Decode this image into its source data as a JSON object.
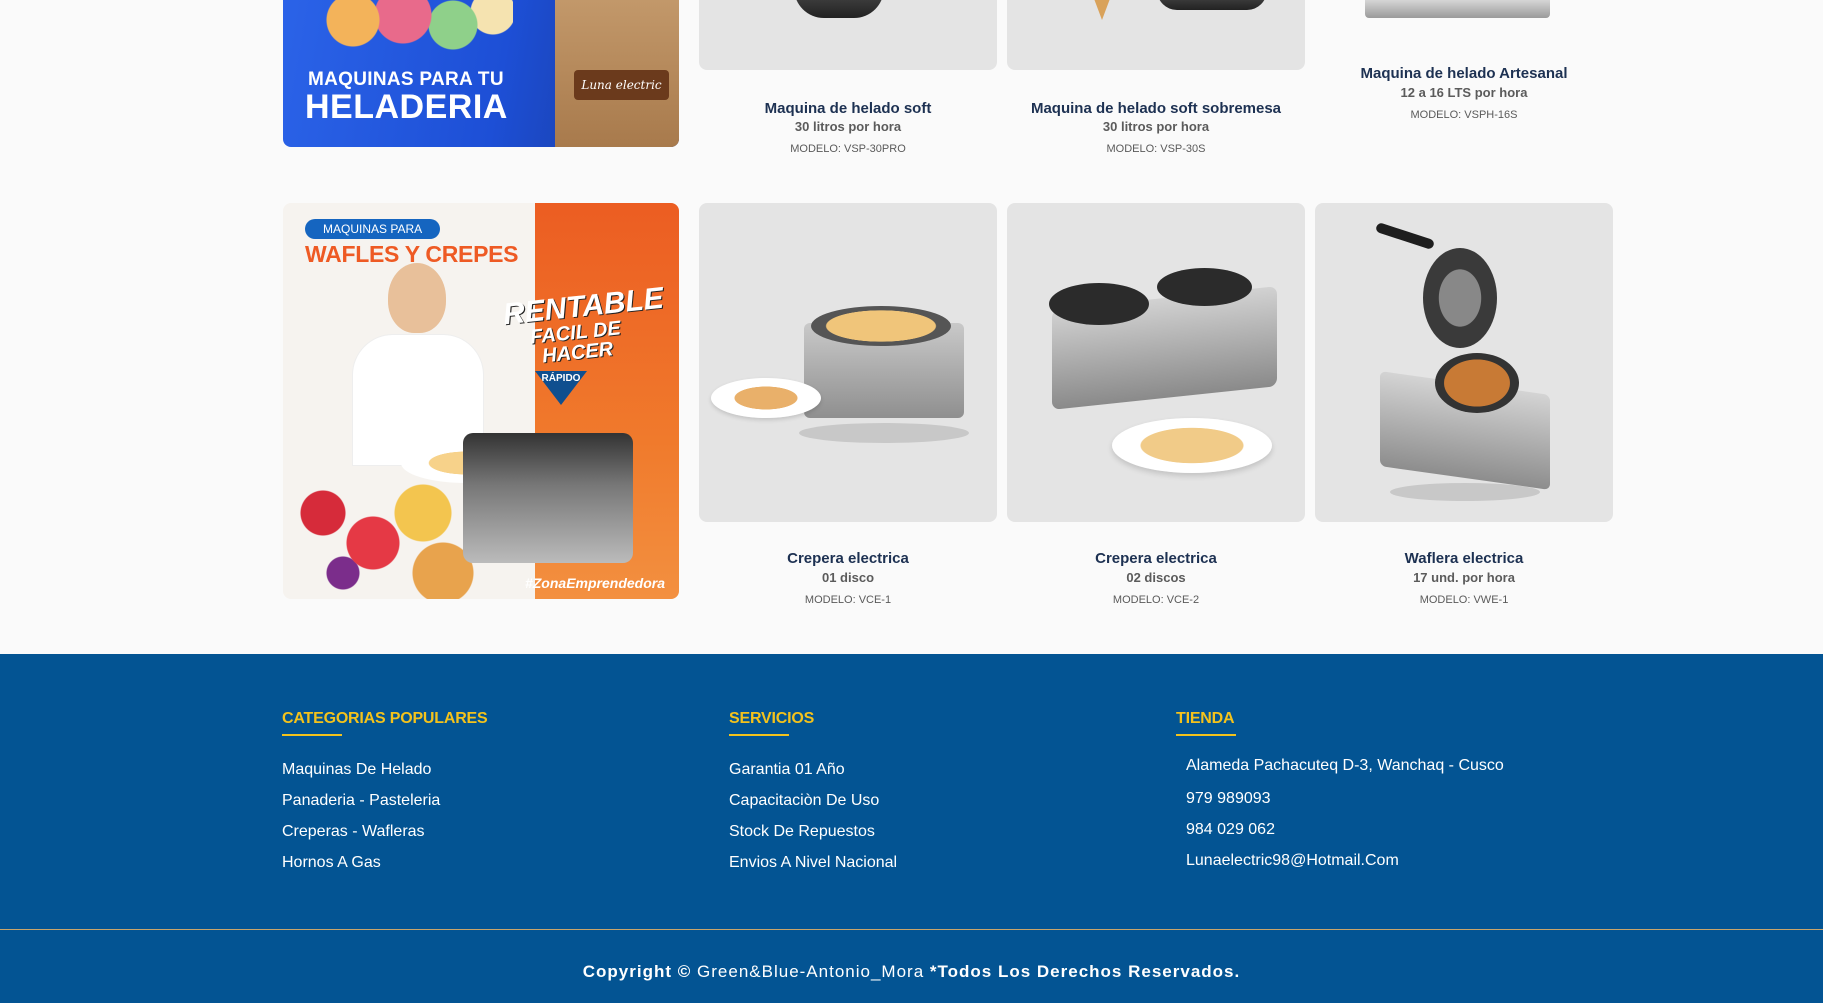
{
  "banners": {
    "helado": {
      "small": "MAQUINAS PARA TU",
      "big": "HELADERIA",
      "brand": "Luna electric"
    },
    "wafles": {
      "pill": "MAQUINAS PARA",
      "title": "WAFLES Y CREPES",
      "slogan1": "RENTABLE",
      "slogan2": "FACIL DE HACER",
      "badge": "RÁPIDO",
      "hashtag": "#ZonaEmprendedora"
    }
  },
  "products_row1": [
    {
      "name": "Maquina de helado soft",
      "spec": "30 litros por hora",
      "model": "MODELO: VSP-30PRO"
    },
    {
      "name": "Maquina de helado soft sobremesa",
      "spec": "30 litros por hora",
      "model": "MODELO: VSP-30S"
    },
    {
      "name": "Maquina de helado Artesanal",
      "spec": "12 a 16 LTS por hora",
      "model": "MODELO: VSPH-16S"
    }
  ],
  "products_row2": [
    {
      "name": "Crepera electrica",
      "spec": "01 disco",
      "model": "MODELO: VCE-1"
    },
    {
      "name": "Crepera electrica",
      "spec": "02 discos",
      "model": "MODELO: VCE-2"
    },
    {
      "name": "Waflera electrica",
      "spec": "17 und. por hora",
      "model": "MODELO: VWE-1"
    }
  ],
  "footer": {
    "categorias": {
      "heading": "CATEGORIAS POPULARES",
      "items": [
        "Maquinas De Helado",
        "Panaderia - Pasteleria",
        "Creperas - Wafleras",
        "Hornos A Gas"
      ]
    },
    "servicios": {
      "heading": "SERVICIOS",
      "items": [
        "Garantia 01 Año",
        "Capacitaciòn De Uso",
        "Stock De Repuestos",
        "Envios A Nivel Nacional"
      ]
    },
    "tienda": {
      "heading": "TIENDA",
      "address": "Alameda Pachacuteq D-3, Wanchaq - Cusco",
      "phone1": "979 989093",
      "phone2": "984 029 062",
      "email": "Lunaelectric98@Hotmail.Com"
    },
    "copyright": {
      "prefix": "Copyright ©",
      "author": "Green&Blue-Antonio_Mora",
      "suffix": "*Todos Los Derechos Reservados."
    }
  },
  "colors": {
    "footer_bg": "#035493",
    "accent_yellow": "#f3c21c",
    "product_title": "#1d3152",
    "card_bg": "#e4e4e4"
  }
}
